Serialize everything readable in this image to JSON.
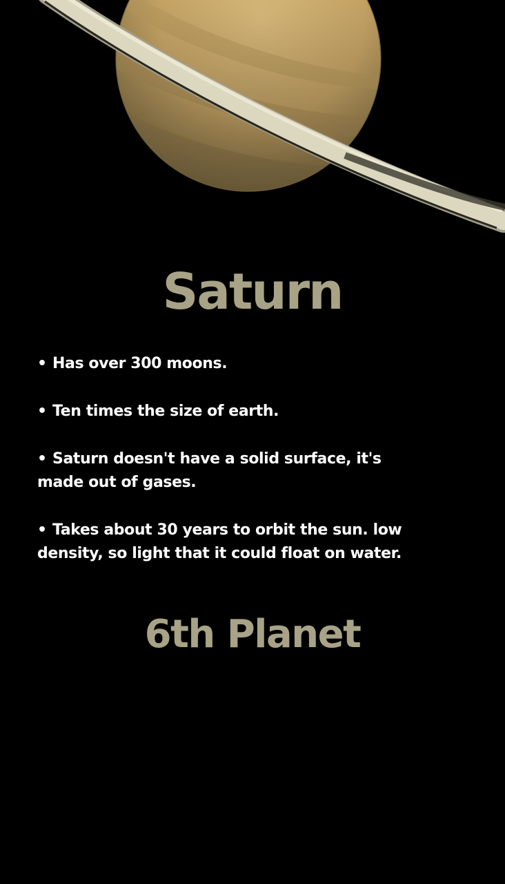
{
  "title": "Saturn",
  "facts": [
    "Has over 300 moons.",
    "Ten times the size of earth.",
    "Saturn doesn't have a solid surface, it's made out of gases.",
    "Takes about 30 years to orbit the sun. low density, so light that it could float on water."
  ],
  "bullet": "•",
  "subtitle": "6th Planet",
  "colors": {
    "background": "#000000",
    "heading": "#a8a386",
    "body_text": "#ffffff",
    "planet": "#e4be7a",
    "ring": "#d8d4bc"
  }
}
